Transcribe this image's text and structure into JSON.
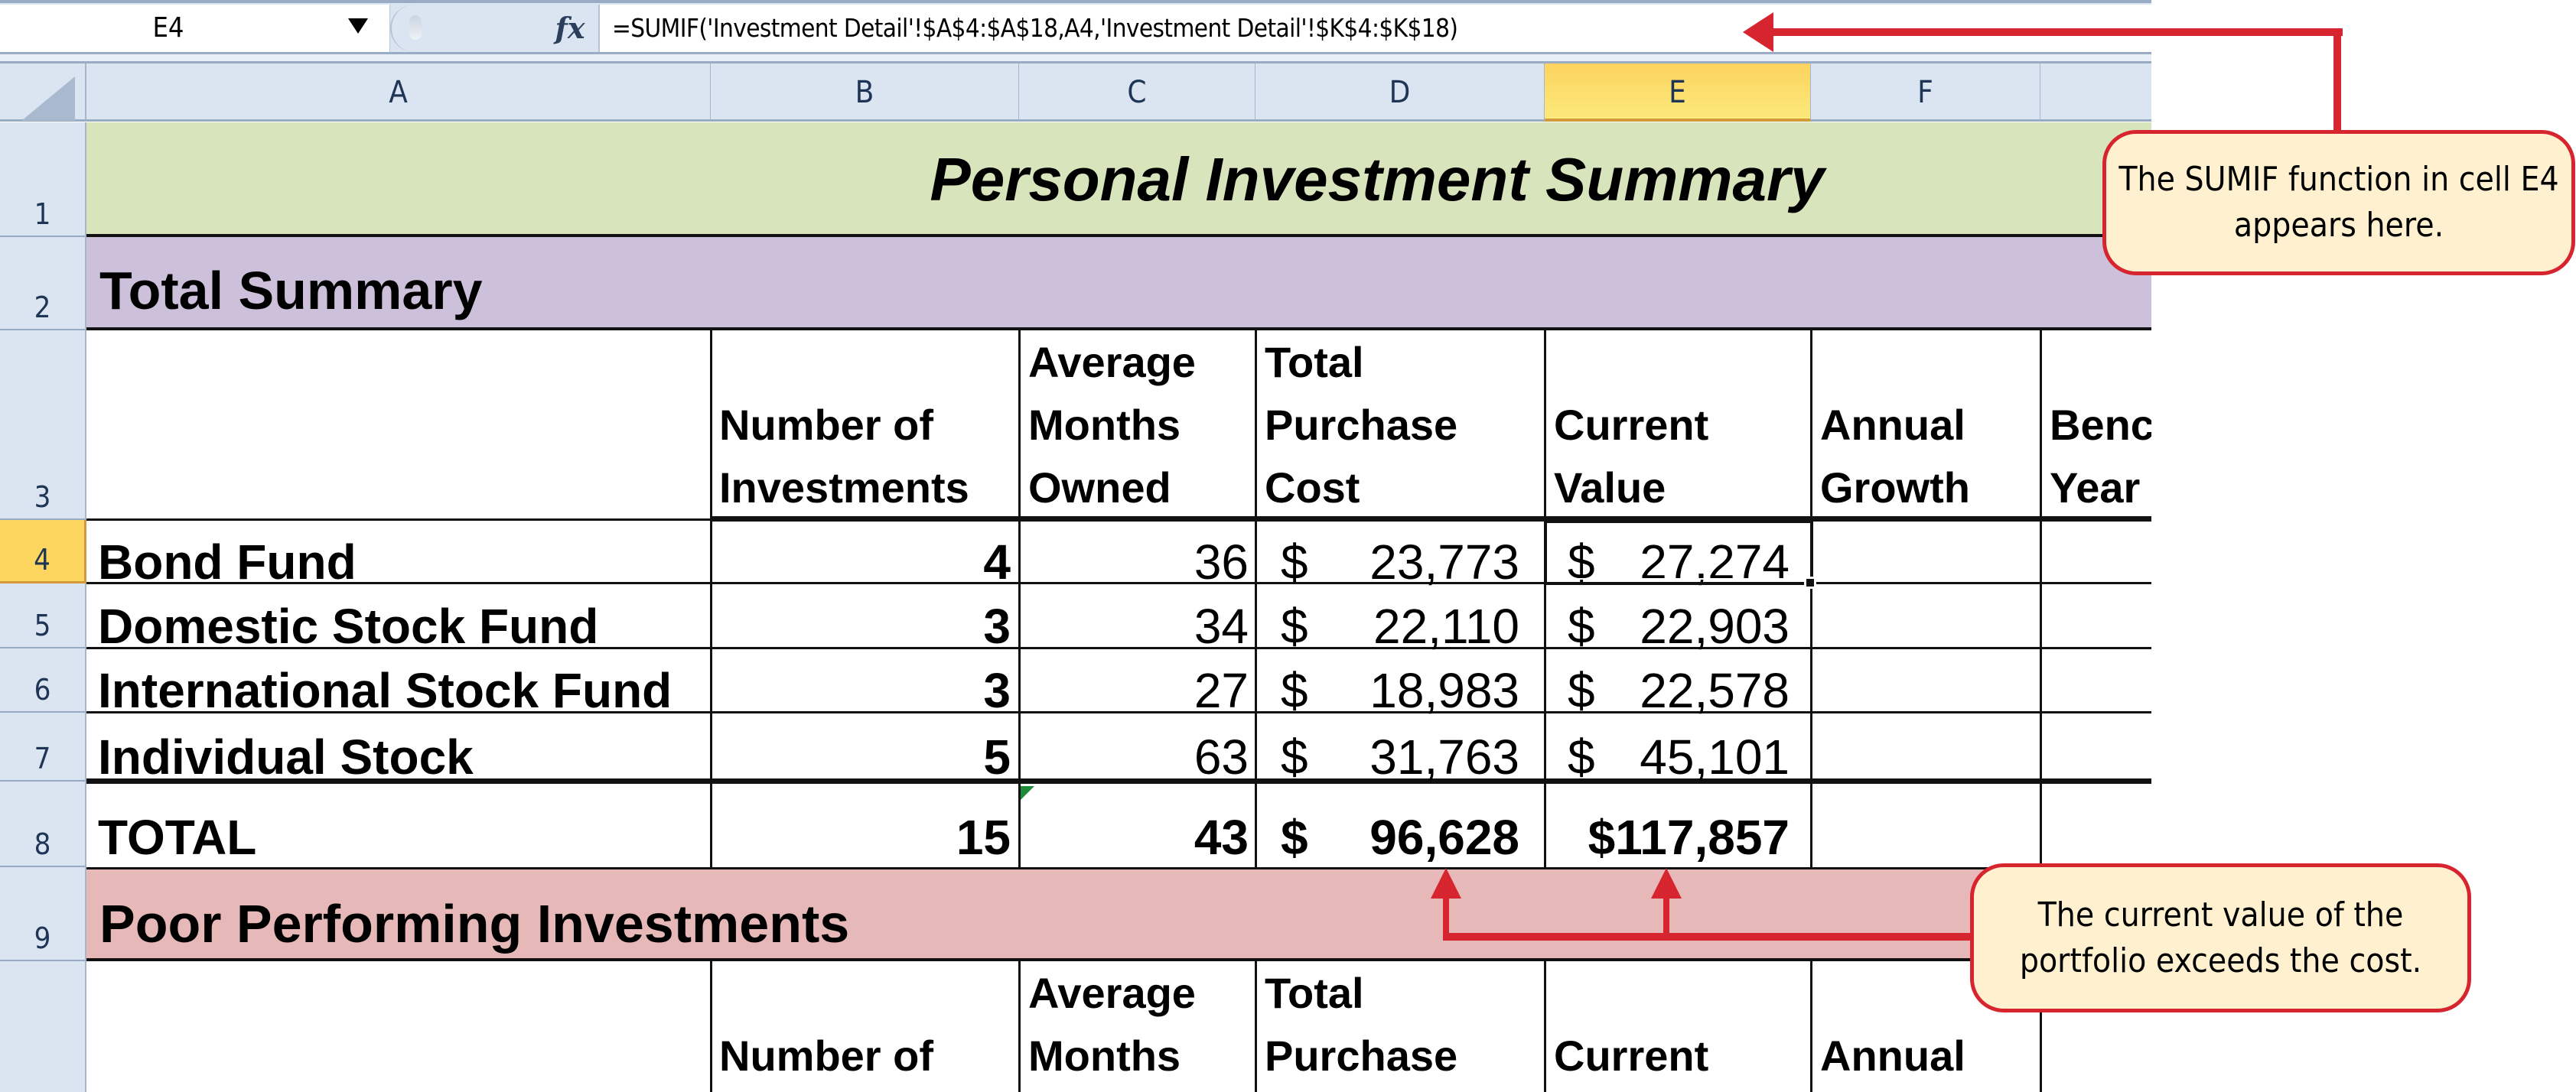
{
  "formula_bar": {
    "name_box": "E4",
    "fx_icon": "fx-icon",
    "formula": "=SUMIF('Investment Detail'!$A$4:$A$18,A4,'Investment Detail'!$K$4:$K$18)"
  },
  "columns": [
    "A",
    "B",
    "C",
    "D",
    "E",
    "F"
  ],
  "selected_column": "E",
  "rows": [
    "1",
    "2",
    "3",
    "4",
    "5",
    "6",
    "7",
    "8",
    "9",
    ""
  ],
  "selected_row": "4",
  "sheet": {
    "title": "Personal Investment Summary",
    "section1": "Total Summary",
    "section2": "Poor Performing Investments",
    "headers": {
      "number_of_investments": "Number of\nInvestments",
      "average_months_owned": "Average\nMonths\nOwned",
      "total_purchase_cost": "Total\nPurchase\nCost",
      "current_value": "Current\nValue",
      "annual_growth": "Annual\nGrowth",
      "benchmark_partial": "Benc\nYear"
    },
    "headers_row10": {
      "number_of": "Number of",
      "average_months": "Average\nMonths",
      "total_purchase": "Total\nPurchase",
      "current": "Current",
      "annual": "Annual"
    },
    "data": [
      {
        "name": "Bond Fund",
        "count": "4",
        "months": "36",
        "cost_symbol": "$",
        "cost": "23,773",
        "value_symbol": "$",
        "value": "27,274"
      },
      {
        "name": "Domestic Stock Fund",
        "count": "3",
        "months": "34",
        "cost_symbol": "$",
        "cost": "22,110",
        "value_symbol": "$",
        "value": "22,903"
      },
      {
        "name": "International Stock Fund",
        "count": "3",
        "months": "27",
        "cost_symbol": "$",
        "cost": "18,983",
        "value_symbol": "$",
        "value": "22,578"
      },
      {
        "name": "Individual Stock",
        "count": "5",
        "months": "63",
        "cost_symbol": "$",
        "cost": "31,763",
        "value_symbol": "$",
        "value": "45,101"
      }
    ],
    "total": {
      "name": "TOTAL",
      "count": "15",
      "months": "43",
      "cost_symbol": "$",
      "cost": "96,628",
      "value": "$117,857"
    }
  },
  "callouts": {
    "sumif": "The SUMIF function in cell E4 appears here.",
    "portfolio": "The current value of the portfolio exceeds the cost."
  },
  "colors": {
    "title_band": "#d8e4bc",
    "summary_band": "#ccc0da",
    "poor_band": "#e6b8b7",
    "callout_fill": "#fff1d0",
    "callout_red": "#d6252f",
    "selected_header": "#fdd660"
  }
}
